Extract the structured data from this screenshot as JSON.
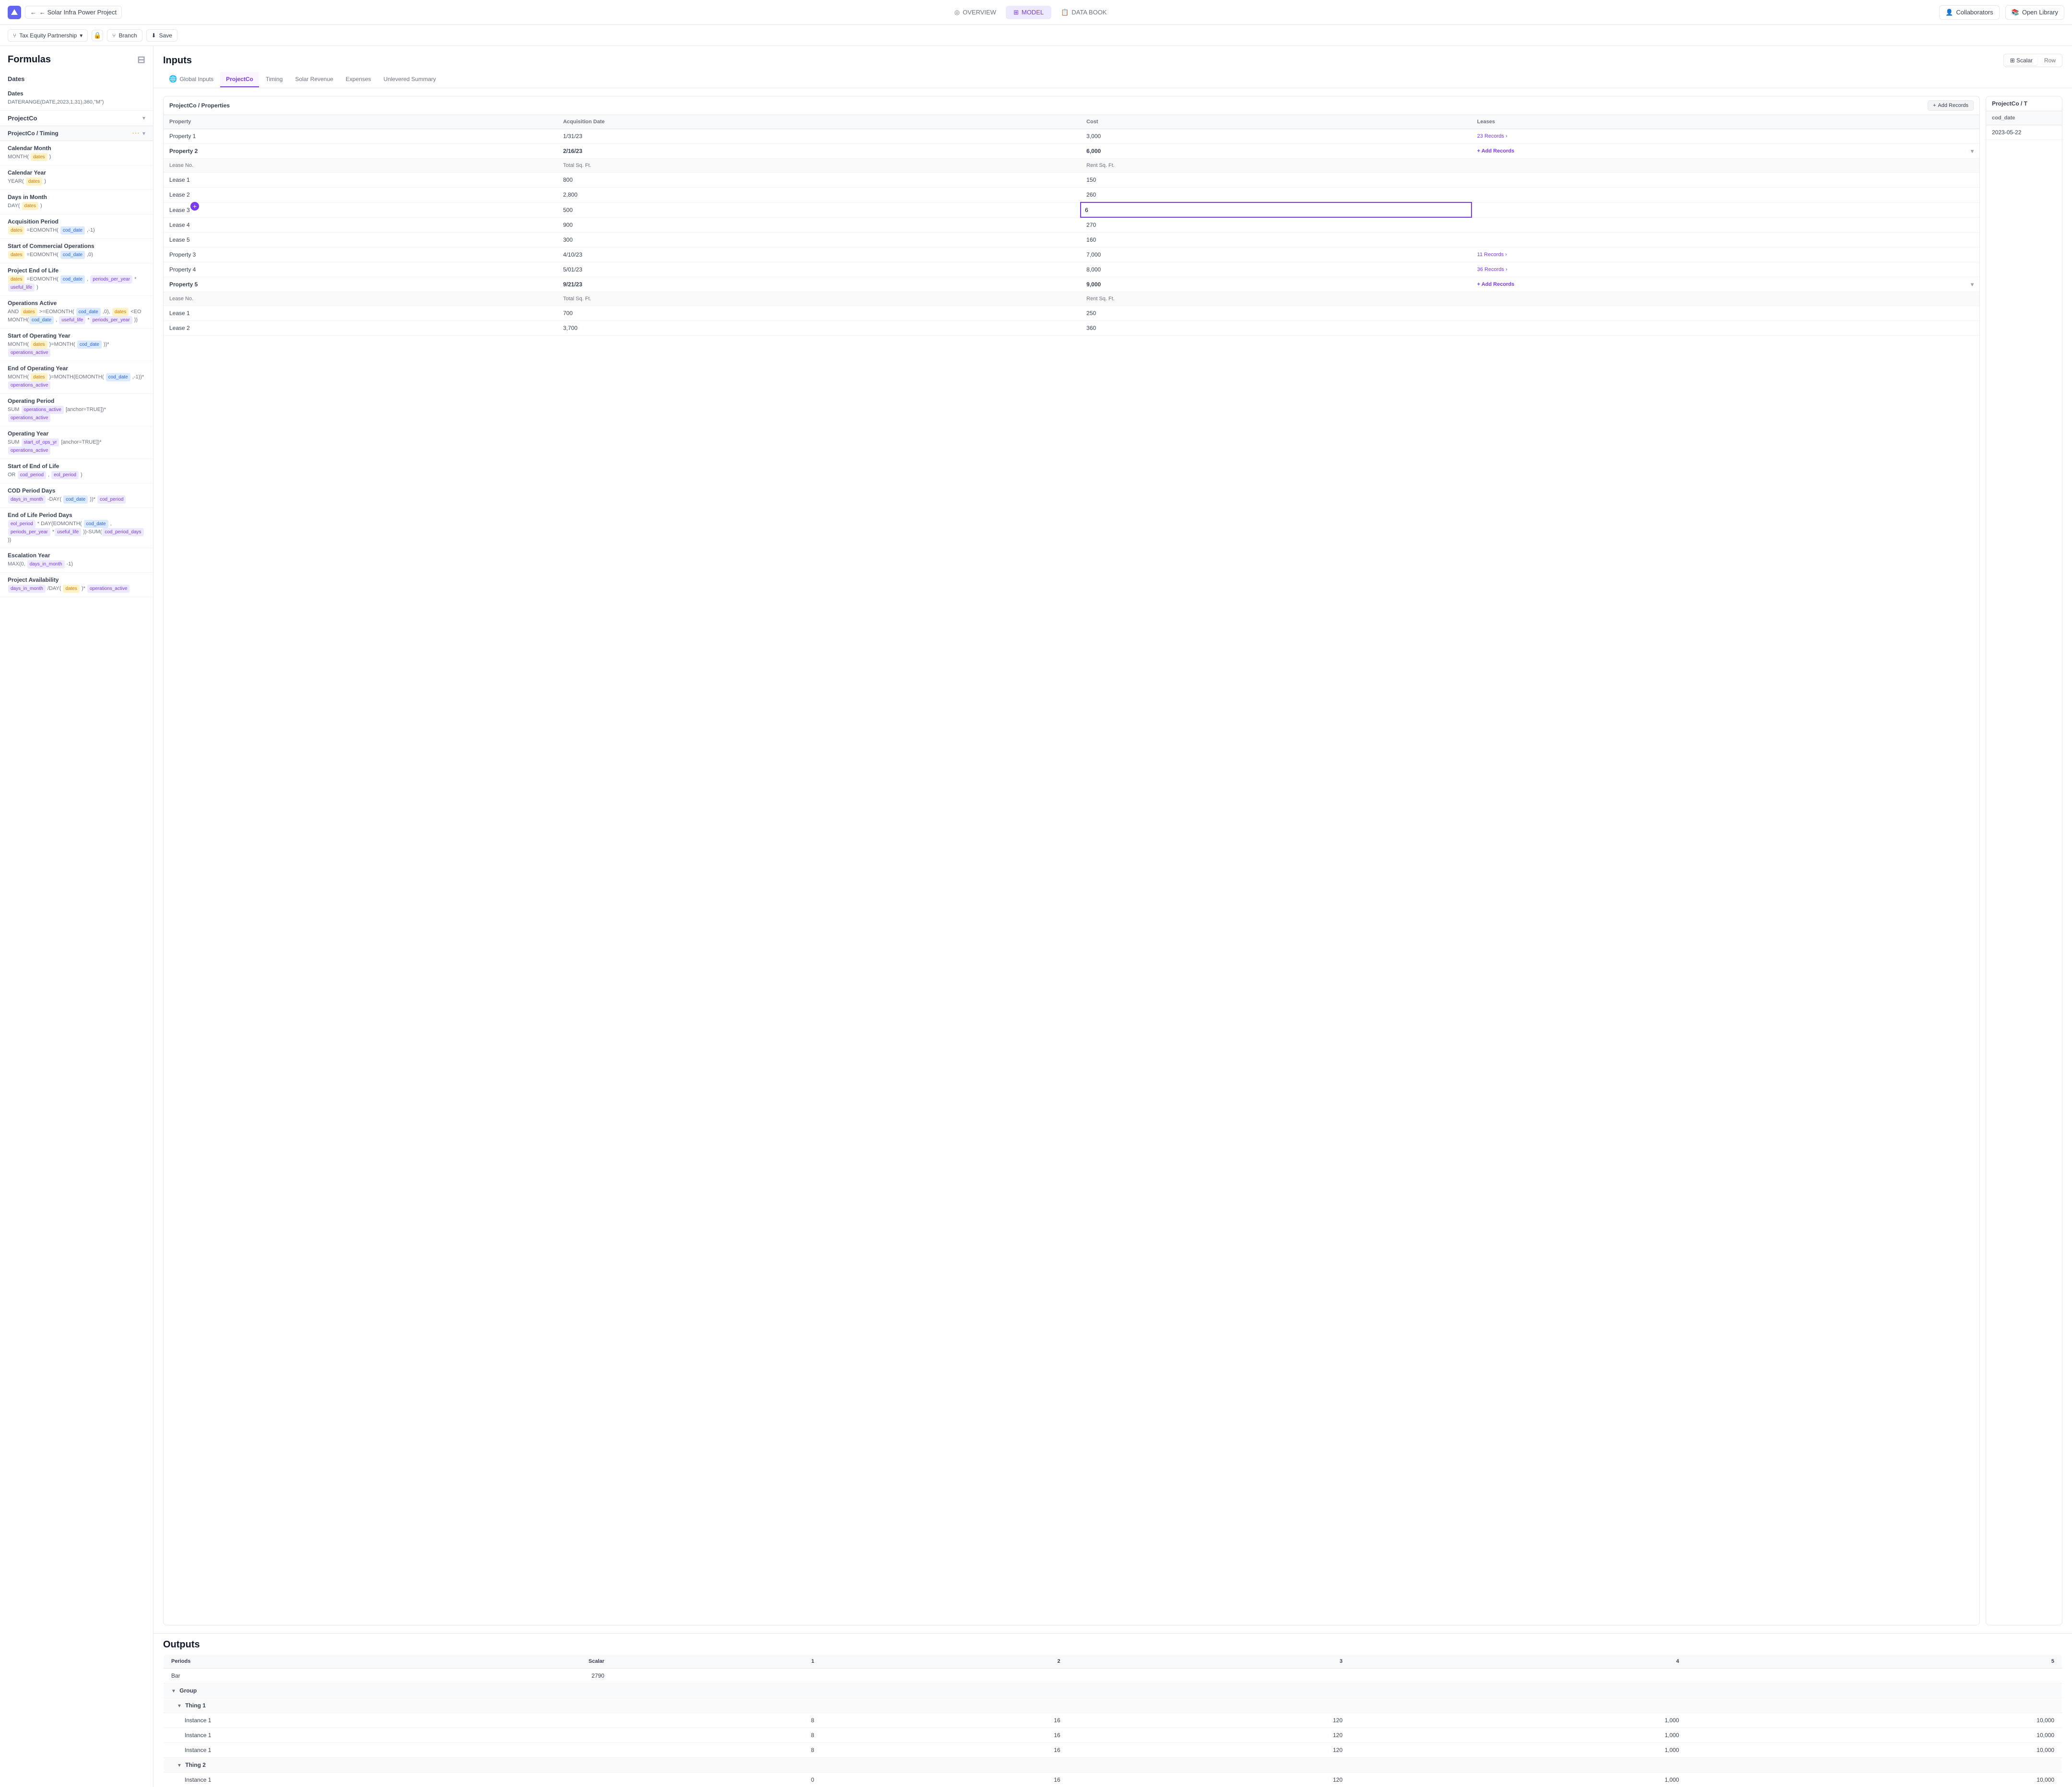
{
  "topNav": {
    "logo_label": "logo",
    "back_label": "← Solar Infra Power Project",
    "tabs": [
      {
        "id": "overview",
        "label": "OVERVIEW",
        "active": false
      },
      {
        "id": "model",
        "label": "MODEL",
        "active": true
      },
      {
        "id": "databook",
        "label": "DATA BOOK",
        "active": false
      }
    ],
    "collaborators_label": "Collaborators",
    "open_library_label": "Open Library"
  },
  "toolbar": {
    "partnership_label": "Tax Equity Partnership",
    "branch_label": "Branch",
    "save_label": "Save"
  },
  "formulas": {
    "title": "Formulas",
    "sections": [
      {
        "id": "dates",
        "label": "Dates",
        "items": [
          {
            "name": "Dates",
            "expr": "DATERANGE(DATE,2023,1,31),360,\"M\")"
          }
        ]
      },
      {
        "id": "projectco",
        "label": "ProjectCo",
        "expanded": true,
        "subsections": [
          {
            "id": "timing",
            "label": "ProjectCo / Timing",
            "items": [
              {
                "name": "Calendar Month",
                "expr_parts": [
                  {
                    "text": "MONTH("
                  },
                  {
                    "tag": "dates",
                    "color": "orange"
                  },
                  {
                    "text": ")"
                  }
                ]
              },
              {
                "name": "Calendar Year",
                "expr_parts": [
                  {
                    "text": "YEAR("
                  },
                  {
                    "tag": "dates",
                    "color": "orange"
                  },
                  {
                    "text": ")"
                  }
                ]
              },
              {
                "name": "Days in Month",
                "expr_parts": [
                  {
                    "text": "DAY("
                  },
                  {
                    "tag": "dates",
                    "color": "orange"
                  },
                  {
                    "text": ")"
                  }
                ]
              },
              {
                "name": "Acquisition Period",
                "expr_parts": [
                  {
                    "tag": "dates",
                    "color": "orange"
                  },
                  {
                    "text": " =EOMONTH("
                  },
                  {
                    "tag": "cod_date",
                    "color": "blue"
                  },
                  {
                    "text": ",-1)"
                  }
                ]
              },
              {
                "name": "Start of Commercial Operations",
                "expr_parts": [
                  {
                    "tag": "dates",
                    "color": "orange"
                  },
                  {
                    "text": " =EOMONTH("
                  },
                  {
                    "tag": "cod_date",
                    "color": "blue"
                  },
                  {
                    "text": ",0)"
                  }
                ]
              },
              {
                "name": "Project End of Life",
                "expr_parts": [
                  {
                    "tag": "dates",
                    "color": "orange"
                  },
                  {
                    "text": " =EOMONTH("
                  },
                  {
                    "tag": "cod_date",
                    "color": "blue"
                  },
                  {
                    "text": ","
                  },
                  {
                    "tag": "periods_per_year",
                    "color": "purple"
                  },
                  {
                    "text": " *"
                  },
                  {
                    "tag": "useful_life",
                    "color": "purple"
                  },
                  {
                    "text": ")"
                  }
                ]
              },
              {
                "name": "Operations Active",
                "expr_parts": [
                  {
                    "text": "AND "
                  },
                  {
                    "tag": "dates",
                    "color": "orange"
                  },
                  {
                    "text": " >=EOMONTH("
                  },
                  {
                    "tag": "cod_date",
                    "color": "blue"
                  },
                  {
                    "text": ",0), "
                  },
                  {
                    "tag": "dates",
                    "color": "orange"
                  },
                  {
                    "text": " <EOMONTH("
                  },
                  {
                    "tag": "cod_date",
                    "color": "blue"
                  },
                  {
                    "text": ","
                  },
                  {
                    "tag": "useful_life",
                    "color": "purple"
                  },
                  {
                    "text": " *"
                  },
                  {
                    "tag": "periods_per_year",
                    "color": "purple"
                  },
                  {
                    "text": " ))"
                  }
                ]
              },
              {
                "name": "Start of Operating Year",
                "expr_parts": [
                  {
                    "text": "MONTH("
                  },
                  {
                    "tag": "dates",
                    "color": "orange"
                  },
                  {
                    "text": ")=MONTH("
                  },
                  {
                    "tag": "cod_date",
                    "color": "blue"
                  },
                  {
                    "text": "))* "
                  },
                  {
                    "tag": "operations_active",
                    "color": "purple"
                  }
                ]
              },
              {
                "name": "End of Operating Year",
                "expr_parts": [
                  {
                    "text": "MONTH("
                  },
                  {
                    "tag": "dates",
                    "color": "orange"
                  },
                  {
                    "text": ")=MONTH(EOMONTH("
                  },
                  {
                    "tag": "cod_date",
                    "color": "blue"
                  },
                  {
                    "text": ",-1))* "
                  },
                  {
                    "tag": "operations_active",
                    "color": "purple"
                  }
                ]
              },
              {
                "name": "Operating Period",
                "expr_parts": [
                  {
                    "text": "SUM "
                  },
                  {
                    "tag": "operations_active",
                    "color": "purple"
                  },
                  {
                    "text": " [anchor=TRUE])* "
                  },
                  {
                    "tag": "operations_active",
                    "color": "purple"
                  }
                ]
              },
              {
                "name": "Operating Year",
                "expr_parts": [
                  {
                    "text": "SUM "
                  },
                  {
                    "tag": "start_of_ops_yr",
                    "color": "purple"
                  },
                  {
                    "text": " [anchor=TRUE])* "
                  },
                  {
                    "tag": "operations_active",
                    "color": "purple"
                  }
                ]
              },
              {
                "name": "Start of End of Life",
                "expr_parts": [
                  {
                    "text": "OR "
                  },
                  {
                    "tag": "cod_period",
                    "color": "purple"
                  },
                  {
                    "text": ", "
                  },
                  {
                    "tag": "eol_period",
                    "color": "purple"
                  },
                  {
                    "text": ")"
                  }
                ]
              },
              {
                "name": "COD Period Days",
                "expr_parts": [
                  {
                    "tag": "days_in_month",
                    "color": "purple"
                  },
                  {
                    "text": " -DAY("
                  },
                  {
                    "tag": "cod_date",
                    "color": "blue"
                  },
                  {
                    "text": "))* "
                  },
                  {
                    "tag": "cod_period",
                    "color": "purple"
                  }
                ]
              },
              {
                "name": "End of Life Period Days",
                "expr_parts": [
                  {
                    "tag": "eol_period",
                    "color": "purple"
                  },
                  {
                    "text": " * DAY(EOMONTH("
                  },
                  {
                    "tag": "cod_date",
                    "color": "blue"
                  },
                  {
                    "text": ","
                  },
                  {
                    "tag": "periods_per_year",
                    "color": "purple"
                  },
                  {
                    "text": " *"
                  },
                  {
                    "tag": "useful_life",
                    "color": "purple"
                  },
                  {
                    "text": " ))-SUM("
                  },
                  {
                    "tag": "cod_period_days",
                    "color": "purple"
                  },
                  {
                    "text": " ))"
                  }
                ]
              },
              {
                "name": "Escalation Year",
                "expr_parts": [
                  {
                    "text": "MAX(0, "
                  },
                  {
                    "tag": "days_in_month",
                    "color": "purple"
                  },
                  {
                    "text": " -1)"
                  }
                ]
              },
              {
                "name": "Project Availability",
                "expr_parts": [
                  {
                    "tag": "days_in_month",
                    "color": "purple"
                  },
                  {
                    "text": " /DAY("
                  },
                  {
                    "tag": "dates",
                    "color": "orange"
                  },
                  {
                    "text": ")* "
                  },
                  {
                    "tag": "operations_active",
                    "color": "purple"
                  }
                ]
              }
            ]
          }
        ]
      }
    ]
  },
  "inputs": {
    "title": "Inputs",
    "view_scalar": "Scalar",
    "view_row": "Row",
    "active_view": "scalar",
    "tabs": [
      {
        "id": "global",
        "label": "Global Inputs",
        "active": false,
        "icon": "🌐"
      },
      {
        "id": "projectco",
        "label": "ProjectCo",
        "active": true
      },
      {
        "id": "timing",
        "label": "Timing",
        "active": false
      },
      {
        "id": "solar_revenue",
        "label": "Solar Revenue",
        "active": false
      },
      {
        "id": "expenses",
        "label": "Expenses",
        "active": false
      },
      {
        "id": "unlevered_summary",
        "label": "Unlevered Summary",
        "active": false
      }
    ],
    "breadcrumb": "ProjectCo / Properties",
    "add_records_label": "Add Records",
    "table_headers": [
      "Property",
      "Acquisition Date",
      "Cost",
      "Leases"
    ],
    "properties": [
      {
        "name": "Property 1",
        "bold": false,
        "acq_date": "1/31/23",
        "cost": "3,000",
        "leases": {
          "type": "records",
          "count": 23,
          "label": "23 Records"
        },
        "expanded": false
      },
      {
        "name": "Property 2",
        "bold": true,
        "acq_date": "2/16/23",
        "cost": "6,000",
        "leases": {
          "type": "add",
          "label": "+ Add Records"
        },
        "expanded": true,
        "sub_headers": [
          "Lease No.",
          "Total Sq. Ft.",
          "Rent Sq. Ft."
        ],
        "leases_data": [
          {
            "no": "Lease 1",
            "total_sqft": "800",
            "rent_sqft": "150"
          },
          {
            "no": "Lease 2",
            "total_sqft": "2,800",
            "rent_sqft": "260"
          },
          {
            "no": "Lease 3",
            "total_sqft": "500",
            "rent_sqft": "6",
            "editing": true
          },
          {
            "no": "Lease 4",
            "total_sqft": "900",
            "rent_sqft": "270"
          },
          {
            "no": "Lease 5",
            "total_sqft": "300",
            "rent_sqft": "160"
          }
        ]
      },
      {
        "name": "Property 3",
        "bold": false,
        "acq_date": "4/10/23",
        "cost": "7,000",
        "leases": {
          "type": "records",
          "count": 11,
          "label": "11 Records"
        },
        "expanded": false
      },
      {
        "name": "Property 4",
        "bold": false,
        "acq_date": "5/01/23",
        "cost": "8,000",
        "leases": {
          "type": "records",
          "count": 36,
          "label": "36 Records"
        },
        "expanded": false
      },
      {
        "name": "Property 5",
        "bold": true,
        "acq_date": "9/21/23",
        "cost": "9,000",
        "leases": {
          "type": "add",
          "label": "+ Add Records"
        },
        "expanded": true,
        "sub_headers": [
          "Lease No.",
          "Total Sq. Ft.",
          "Rent Sq. Ft."
        ],
        "leases_data": [
          {
            "no": "Lease 1",
            "total_sqft": "700",
            "rent_sqft": "250"
          },
          {
            "no": "Lease 2",
            "total_sqft": "3,700",
            "rent_sqft": "360"
          }
        ]
      }
    ],
    "side_table": {
      "header": "ProjectCo / T",
      "col": "cod_date",
      "value": "2023-05-22"
    }
  },
  "outputs": {
    "title": "Outputs",
    "headers": [
      "Periods",
      "Scalar",
      "1",
      "2",
      "3",
      "4",
      "5"
    ],
    "rows": [
      {
        "type": "data",
        "label": "Bar",
        "scalar": "2790",
        "cols": [
          "",
          "",
          "",
          "",
          ""
        ]
      },
      {
        "type": "group",
        "label": "▼ Group",
        "cols": [
          "",
          "",
          "",
          "",
          "",
          ""
        ]
      },
      {
        "type": "thing",
        "label": "▼ Thing 1",
        "cols": [
          "",
          "",
          "",
          "",
          "",
          ""
        ]
      },
      {
        "type": "instance",
        "label": "Instance 1",
        "scalar": "",
        "cols": [
          "8",
          "16",
          "120",
          "1,000",
          "10,000"
        ]
      },
      {
        "type": "instance",
        "label": "Instance 1",
        "scalar": "",
        "cols": [
          "8",
          "16",
          "120",
          "1,000",
          "10,000"
        ]
      },
      {
        "type": "instance",
        "label": "Instance 1",
        "scalar": "",
        "cols": [
          "8",
          "16",
          "120",
          "1,000",
          "10,000"
        ]
      },
      {
        "type": "thing",
        "label": "▼ Thing 2",
        "cols": [
          "",
          "",
          "",
          "",
          "",
          ""
        ]
      },
      {
        "type": "instance",
        "label": "Instance 1",
        "scalar": "",
        "cols": [
          "0",
          "16",
          "120",
          "1,000",
          "10,000"
        ]
      }
    ]
  }
}
